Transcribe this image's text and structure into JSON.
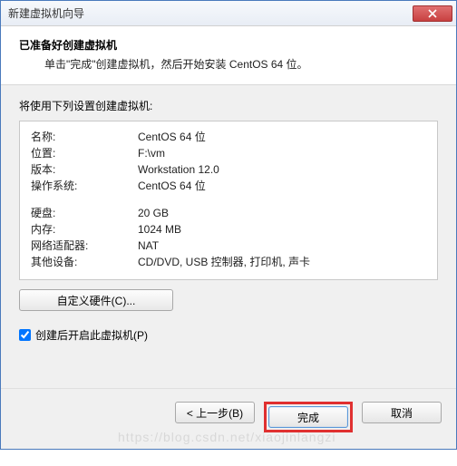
{
  "titlebar": {
    "title": "新建虚拟机向导"
  },
  "header": {
    "title": "已准备好创建虚拟机",
    "subtitle": "单击\"完成\"创建虚拟机，然后开始安装 CentOS 64 位。"
  },
  "settings_label": "将使用下列设置创建虚拟机:",
  "rows_a": [
    {
      "k": "名称:",
      "v": "CentOS 64 位"
    },
    {
      "k": "位置:",
      "v": "F:\\vm"
    },
    {
      "k": "版本:",
      "v": "Workstation 12.0"
    },
    {
      "k": "操作系统:",
      "v": "CentOS 64 位"
    }
  ],
  "rows_b": [
    {
      "k": "硬盘:",
      "v": "20 GB"
    },
    {
      "k": "内存:",
      "v": "1024 MB"
    },
    {
      "k": "网络适配器:",
      "v": "NAT"
    },
    {
      "k": "其他设备:",
      "v": "CD/DVD, USB 控制器, 打印机, 声卡"
    }
  ],
  "custom_hw_label": "自定义硬件(C)...",
  "checkbox_label": "创建后开启此虚拟机(P)",
  "checkbox_checked": true,
  "buttons": {
    "back": "< 上一步(B)",
    "finish": "完成",
    "cancel": "取消"
  },
  "watermark": "https://blog.csdn.net/xiaojinlangzi"
}
